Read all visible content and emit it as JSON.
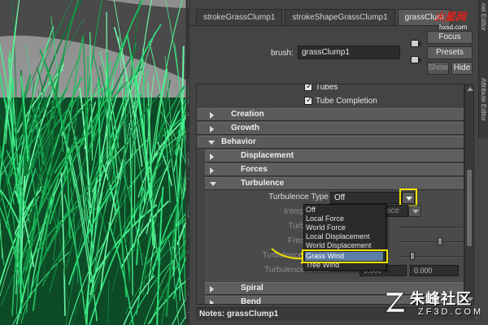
{
  "tabs": [
    {
      "label": "strokeGrassClump1",
      "active": false
    },
    {
      "label": "strokeShapeGrassClump1",
      "active": false
    },
    {
      "label": "grassClum",
      "active": true
    }
  ],
  "side_panel": {
    "upper": "nel Editor",
    "lower": "Attribute Editor"
  },
  "brush": {
    "label": "brush:",
    "value": "grassClump1"
  },
  "buttons": {
    "focus": "Focus",
    "presets": "Presets",
    "show": "Show",
    "hide": "Hide"
  },
  "checks": [
    {
      "label": "Tubes",
      "checked": true
    },
    {
      "label": "Tube Completion",
      "checked": true
    }
  ],
  "sections": {
    "creation": "Creation",
    "growth": "Growth",
    "behavior": "Behavior",
    "displacement": "Displacement",
    "forces": "Forces",
    "turbulence": "Turbulence",
    "spiral": "Spiral",
    "bend": "Bend"
  },
  "turbulence": {
    "type_label": "Turbulence Type",
    "type_value": "Off",
    "interpolation_label": "Interpolation",
    "interpolation_value": "ace",
    "turbulence_label": "Turbulence",
    "frequency_label": "Frequency:",
    "speed_label": "Turbulence Speed",
    "offset_label": "Turbulence Offset",
    "offset_values": [
      "0.000",
      "0.000"
    ]
  },
  "menu": {
    "options": [
      "Off",
      "Local Force",
      "World Force",
      "Local Displacement",
      "World Displacement",
      "Grass Wind",
      "Tree Wind"
    ],
    "selected": "Grass Wind"
  },
  "notes": {
    "label": "Notes: grassClump1"
  },
  "watermarks": {
    "top_logo": "火星网",
    "top_sub": "hxsd.com",
    "bottom_cn": "朱峰社区",
    "bottom_en": "ZF3D.COM"
  },
  "colors": {
    "accent_yellow": "#f0e000",
    "selection_blue": "#5c7da6",
    "grass_green": "#2ee07a"
  }
}
